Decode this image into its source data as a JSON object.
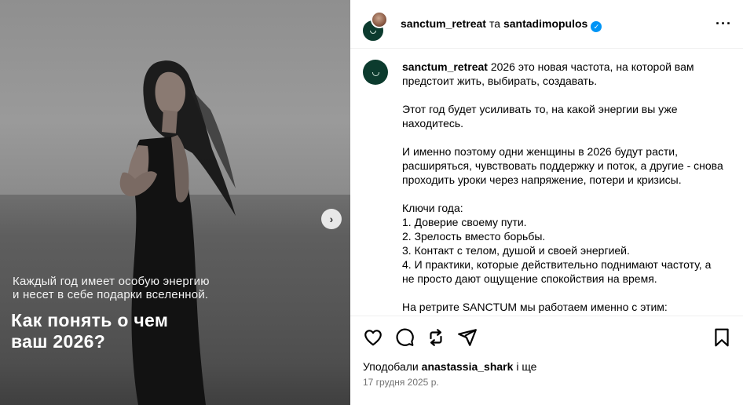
{
  "media": {
    "overlay_subtitle_line1": "Каждый год имеет особую энергию",
    "overlay_subtitle_line2": "и несет в себе подарки вселенной.",
    "overlay_title_line1": "Как понять о чем",
    "overlay_title_line2": "ваш 2026?",
    "next_icon": "chevron-right-icon",
    "next_glyph": "›"
  },
  "header": {
    "user1": "sanctum_retreat",
    "separator": "та",
    "user2": "santadimopulos",
    "verified_icon": "verified-badge-icon",
    "verified_glyph": "✓",
    "more_glyph": "···"
  },
  "caption": {
    "username": "sanctum_retreat",
    "p1": "2026 это новая частота, на которой вам предстоит жить, выбирать, создавать.",
    "p2": "Этот год будет усиливать то, на какой энергии вы уже находитесь.",
    "p3": "И именно поэтому одни женщины в 2026 будут расти, расширяться, чувствовать поддержку и поток, а другие - снова проходить уроки через напряжение, потери и кризисы.",
    "keys_title": "Ключи года:",
    "key1": "1. Доверие своему пути.",
    "key2": "2. Зрелость вместо борьбы.",
    "key3": "3. Контакт с телом, душой и своей энергией.",
    "key4": "4. И практики, которые действительно поднимают частоту, а не просто дают ощущение спокойствия на время.",
    "p5": "На ретрите SANCTUM мы работаем именно с этим:"
  },
  "actions": {
    "like_icon": "heart-icon",
    "comment_icon": "comment-icon",
    "repost_icon": "repost-icon",
    "share_icon": "share-icon",
    "save_icon": "bookmark-icon"
  },
  "likes": {
    "prefix": "Уподобали",
    "user": "anastassia_shark",
    "suffix": "і ще"
  },
  "date": "17 грудня 2025 р.",
  "colors": {
    "brand_green": "#0c3b2e",
    "verified_blue": "#0095f6",
    "muted_text": "#737373"
  }
}
